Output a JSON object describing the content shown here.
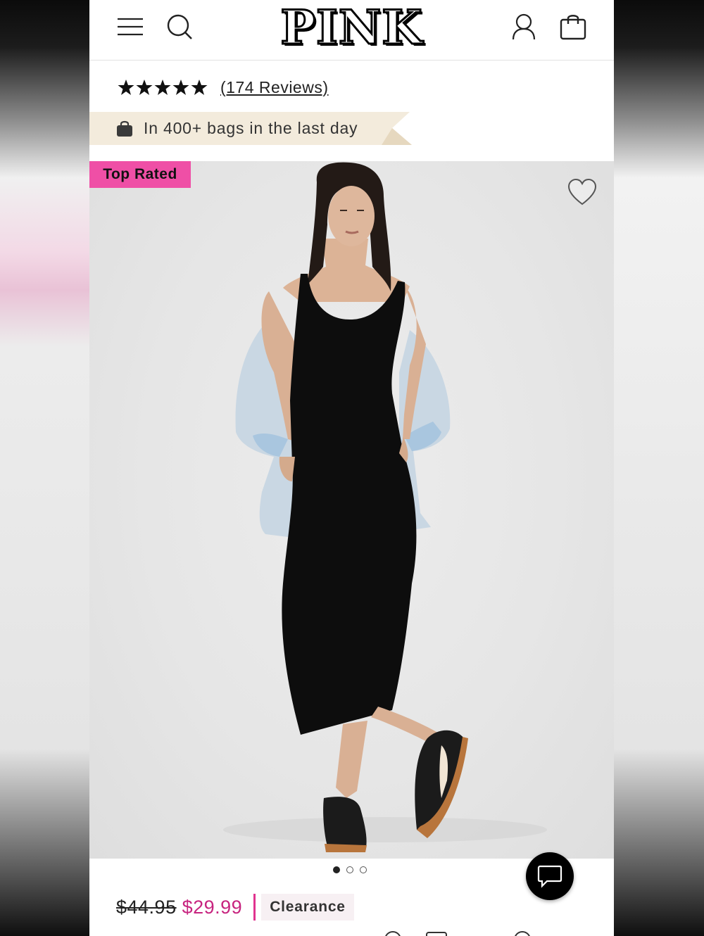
{
  "header": {
    "brand": "PINK",
    "menu_icon": "hamburger-menu-icon",
    "search_icon": "search-icon",
    "account_icon": "user-icon",
    "bag_icon": "shopping-bag-icon"
  },
  "rating": {
    "stars": 5,
    "reviews_label": "(174 Reviews)"
  },
  "popularity_banner": {
    "icon": "bag-icon",
    "text": "In 400+ bags in the last day"
  },
  "product_image": {
    "badge": "Top Rated",
    "wishlist_icon": "heart-icon",
    "carousel": {
      "total": 3,
      "active": 1
    }
  },
  "pricing": {
    "original_price": "$44.95",
    "sale_price": "$29.99",
    "tag": "Clearance"
  },
  "chat": {
    "icon": "chat-bubble-icon"
  },
  "colors": {
    "brand_pink": "#ef4fa6",
    "sale_price": "#c7247f",
    "banner_bg": "#f3ebdc"
  }
}
